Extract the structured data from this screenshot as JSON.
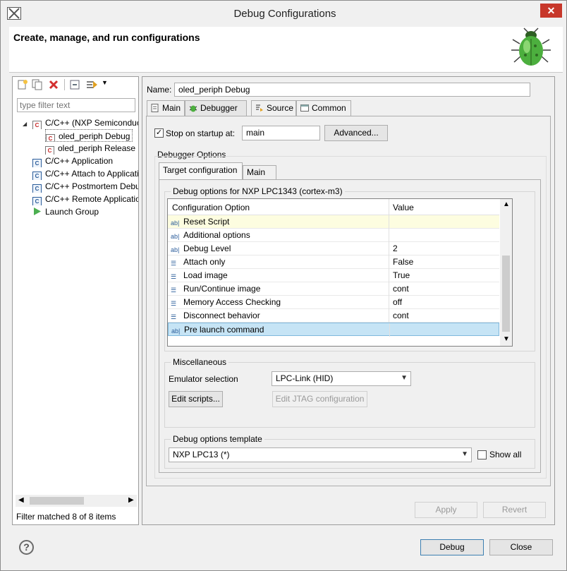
{
  "window": {
    "title": "Debug Configurations",
    "close_glyph": "✕"
  },
  "header": {
    "text": "Create, manage, and run configurations",
    "icon": "bug-icon"
  },
  "left_panel": {
    "toolbar_icons": [
      "new-config-icon",
      "duplicate-icon",
      "delete-icon",
      "collapse-all-icon",
      "filter-icon",
      "dropdown-arrow-icon"
    ],
    "filter_placeholder": "type filter text",
    "tree": [
      {
        "label": "C/C++ (NXP Semiconductors) MCU Application",
        "level": 0,
        "expanded": true,
        "icon": "c-red-icon"
      },
      {
        "label": "oled_periph Debug",
        "level": 1,
        "selected": true,
        "icon": "c-red-icon"
      },
      {
        "label": "oled_periph Release",
        "level": 1,
        "icon": "c-red-icon"
      },
      {
        "label": "C/C++ Application",
        "level": 0,
        "icon": "c-icon"
      },
      {
        "label": "C/C++ Attach to Application",
        "level": 0,
        "icon": "c-icon"
      },
      {
        "label": "C/C++ Postmortem Debugger",
        "level": 0,
        "icon": "c-icon"
      },
      {
        "label": "C/C++ Remote Application",
        "level": 0,
        "icon": "c-icon"
      },
      {
        "label": "Launch Group",
        "level": 0,
        "icon": "launch-group-icon"
      }
    ],
    "filter_status": "Filter matched 8 of 8 items"
  },
  "right_panel": {
    "name_label": "Name:",
    "name_value": "oled_periph Debug",
    "tabs": [
      {
        "label": "Main",
        "icon": "main-tab-icon"
      },
      {
        "label": "Debugger",
        "icon": "debugger-tab-icon",
        "active": true
      },
      {
        "label": "Source",
        "icon": "source-tab-icon"
      },
      {
        "label": "Common",
        "icon": "common-tab-icon"
      }
    ],
    "stop_on_startup": {
      "label": "Stop on startup at:",
      "checked": true,
      "value": "main"
    },
    "advanced_button": "Advanced...",
    "debugger_options_title": "Debugger Options",
    "sub_tabs": [
      "Target configuration",
      "Main"
    ],
    "debug_options_group": "Debug options for NXP LPC1343 (cortex-m3)",
    "table": {
      "headers": [
        "Configuration Option",
        "Value"
      ],
      "rows": [
        {
          "option": "Reset Script",
          "value": "",
          "icon": "text-field-icon"
        },
        {
          "option": "Additional options",
          "value": "",
          "icon": "text-field-icon"
        },
        {
          "option": "Debug Level",
          "value": "2",
          "icon": "text-field-icon"
        },
        {
          "option": "Attach only",
          "value": "False",
          "icon": "list-option-icon"
        },
        {
          "option": "Load image",
          "value": "True",
          "icon": "list-option-icon"
        },
        {
          "option": "Run/Continue image",
          "value": "cont",
          "icon": "list-option-icon"
        },
        {
          "option": "Memory Access Checking",
          "value": "off",
          "icon": "list-option-icon"
        },
        {
          "option": "Disconnect behavior",
          "value": "cont",
          "icon": "list-option-icon"
        },
        {
          "option": "Pre launch command",
          "value": "",
          "icon": "text-field-icon"
        }
      ]
    },
    "misc": {
      "title": "Miscellaneous",
      "emulator_label": "Emulator selection",
      "emulator_value": "LPC-Link (HID)",
      "edit_scripts": "Edit scripts...",
      "edit_jtag": "Edit JTAG configuration"
    },
    "template": {
      "title": "Debug options template",
      "value": "NXP LPC13 (*)",
      "show_all": "Show all"
    },
    "apply_button": "Apply",
    "revert_button": "Revert"
  },
  "footer": {
    "help_glyph": "?",
    "debug_button": "Debug",
    "close_button": "Close"
  },
  "colors": {
    "selected_row": "#c6e4f5",
    "highlight_row": "#fdfde0",
    "delete_red": "#d32f2f"
  }
}
